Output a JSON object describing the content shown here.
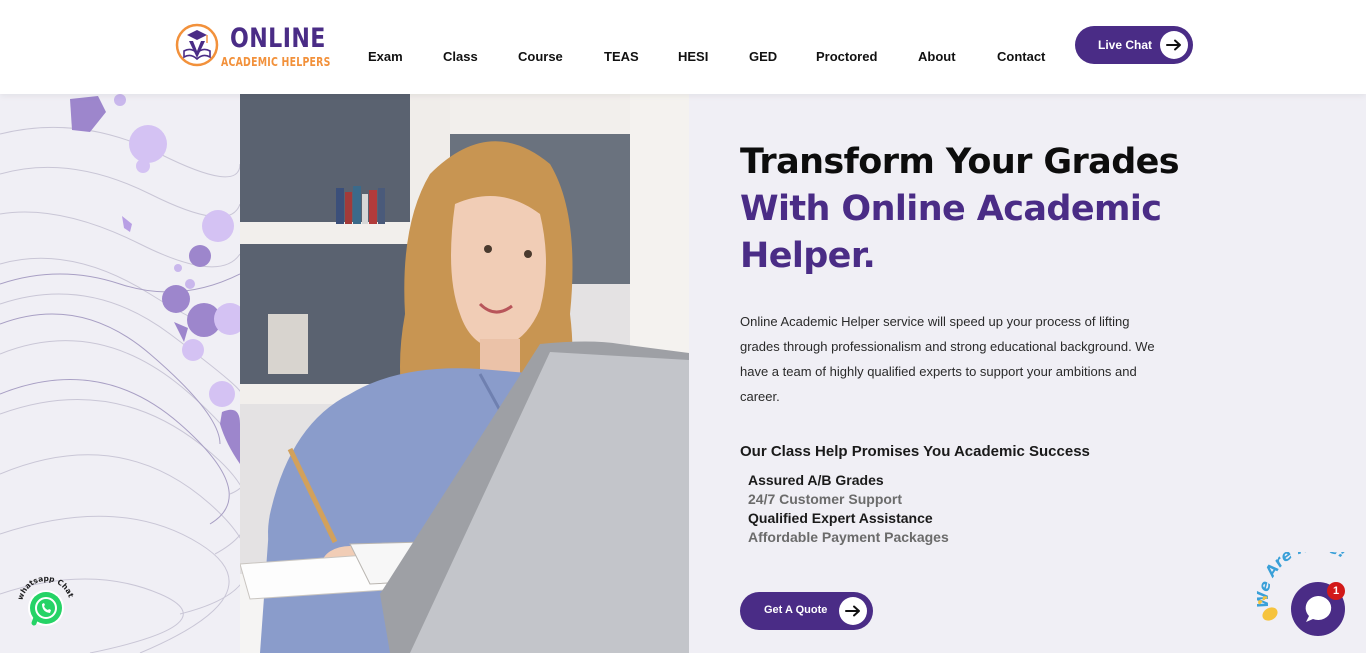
{
  "brand": {
    "name_line1": "ONLINE",
    "name_line2": "ACADEMIC HELPERS",
    "primary_color": "#4a2c86",
    "accent_color": "#f2913b"
  },
  "nav": {
    "items": [
      {
        "label": "Exam"
      },
      {
        "label": "Class"
      },
      {
        "label": "Course"
      },
      {
        "label": "TEAS"
      },
      {
        "label": "HESI"
      },
      {
        "label": "GED"
      },
      {
        "label": "Proctored"
      },
      {
        "label": "About"
      },
      {
        "label": "Contact"
      }
    ],
    "cta_label": "Live Chat",
    "cta_icon": "arrow-right-icon"
  },
  "hero": {
    "headline_line1": "Transform Your Grades",
    "headline_line2": "With Online Academic",
    "headline_line3": "Helper.",
    "description": "Online Academic Helper service will speed up your process of lifting grades through professionalism and strong educational background. We have a team of highly qualified experts to support your ambitions and career.",
    "promises_title": "Our Class Help Promises You Academic Success",
    "promises": [
      {
        "text": "Assured A/B Grades",
        "color": "#1a1a1a"
      },
      {
        "text": "24/7 Customer Support",
        "color": "#6b6b6b"
      },
      {
        "text": "Qualified Expert Assistance",
        "color": "#1a1a1a"
      },
      {
        "text": "Affordable Payment Packages",
        "color": "#6b6b6b"
      }
    ],
    "cta_label": "Get A Quote",
    "cta_icon": "arrow-right-icon",
    "image_description": "woman-writing-at-laptop"
  },
  "widgets": {
    "whatsapp_label": "whatsapp Chat",
    "whatsapp_icon": "whatsapp-icon",
    "chat_label": "We Are Here!",
    "chat_icon": "chat-bubble-icon",
    "chat_badge": "1"
  }
}
